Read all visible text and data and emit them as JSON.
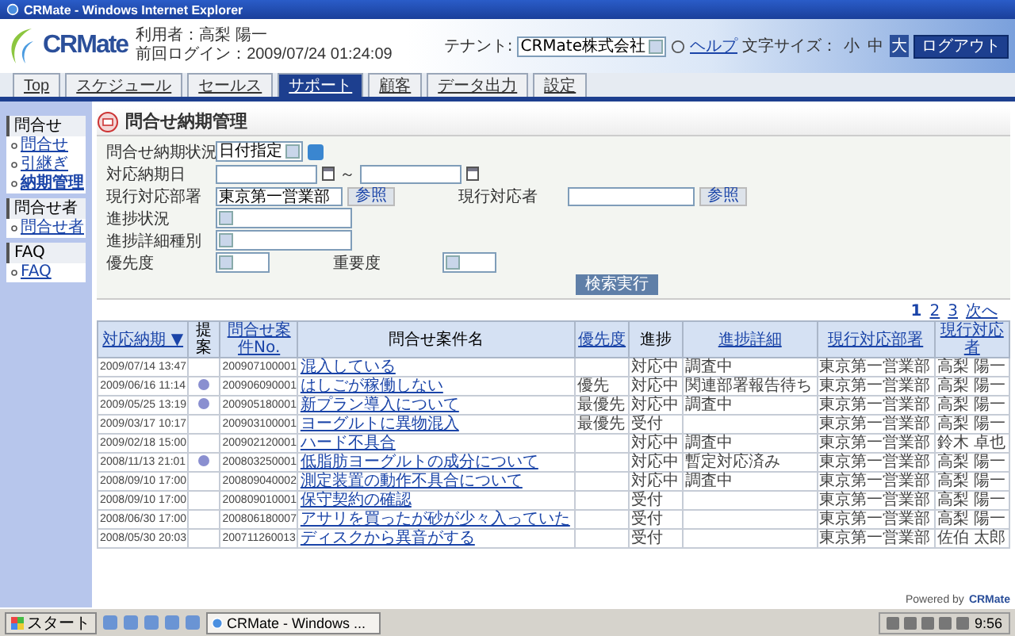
{
  "window": {
    "title": "CRMate - Windows Internet Explorer"
  },
  "header": {
    "logo": "CRMate",
    "user_label": "利用者：",
    "user_name": "高梨 陽一",
    "last_login": "前回ログイン：2009/07/24 01:24:09",
    "tenant_label": "テナント:",
    "tenant": "CRMate株式会社",
    "help": "ヘルプ",
    "font_size_label": "文字サイズ：",
    "font_sizes": [
      {
        "label": "小",
        "selected": false
      },
      {
        "label": "中",
        "selected": false
      },
      {
        "label": "大",
        "selected": true
      }
    ],
    "logout": "ログアウト"
  },
  "nav": [
    {
      "label": "Top",
      "selected": false
    },
    {
      "label": "スケジュール",
      "selected": false
    },
    {
      "label": "セールス",
      "selected": false
    },
    {
      "label": "サポート",
      "selected": true
    },
    {
      "label": "顧客",
      "selected": false
    },
    {
      "label": "データ出力",
      "selected": false
    },
    {
      "label": "設定",
      "selected": false
    }
  ],
  "sidebar": [
    {
      "title": "問合せ",
      "items": [
        {
          "label": "問合せ",
          "selected": false
        },
        {
          "label": "引継ぎ",
          "selected": false
        },
        {
          "label": "納期管理",
          "selected": true
        }
      ]
    },
    {
      "title": "問合せ者",
      "items": [
        {
          "label": "問合せ者",
          "selected": false
        }
      ]
    },
    {
      "title": "FAQ",
      "items": [
        {
          "label": "FAQ",
          "selected": false
        }
      ]
    }
  ],
  "page_title": "問合せ納期管理",
  "form": [
    {
      "fields": [
        {
          "kind": "select",
          "label": "問合せ納期状況",
          "value": "日付指定",
          "help": true
        }
      ]
    },
    {
      "fields": [
        {
          "kind": "date_range",
          "label": "対応納期日",
          "separator": "～"
        }
      ]
    },
    {
      "fields": [
        {
          "kind": "reference",
          "label": "現行対応部署",
          "value": "東京第一営業部",
          "button": "参照"
        },
        {
          "kind": "reference",
          "label": "現行対応者",
          "button": "参照"
        }
      ]
    },
    {
      "fields": [
        {
          "kind": "select",
          "label": "進捗状況",
          "wide": true
        }
      ]
    },
    {
      "fields": [
        {
          "kind": "select",
          "label": "進捗詳細種別",
          "wide": true
        }
      ]
    },
    {
      "fields": [
        {
          "kind": "select",
          "label": "優先度"
        },
        {
          "kind": "select",
          "label": "重要度"
        }
      ]
    }
  ],
  "search_button": "検索実行",
  "pagination": [
    {
      "label": "1",
      "selected": true
    },
    {
      "label": "2",
      "selected": false
    },
    {
      "label": "3",
      "selected": false
    },
    {
      "label": "次へ",
      "selected": false
    }
  ],
  "table": {
    "columns": [
      {
        "label": "対応納期 ▼",
        "sortable": true
      },
      {
        "label": "提案",
        "sortable": false
      },
      {
        "label": "問合せ案件No.",
        "sortable": true
      },
      {
        "label": "問合せ案件名",
        "sortable": false
      },
      {
        "label": "優先度",
        "sortable": true
      },
      {
        "label": "進捗",
        "sortable": false
      },
      {
        "label": "進捗詳細",
        "sortable": true
      },
      {
        "label": "現行対応部署",
        "sortable": true
      },
      {
        "label": "現行対応者",
        "sortable": true
      }
    ],
    "rows": [
      {
        "due": "2009/07/14 13:47",
        "suggested": false,
        "no": "200907100001",
        "name": "混入している",
        "priority": "",
        "progress": "対応中",
        "detail": "調査中",
        "dept": "東京第一営業部",
        "person": "高梨 陽一"
      },
      {
        "due": "2009/06/16 11:14",
        "suggested": true,
        "no": "200906090001",
        "name": "はしごが稼働しない",
        "priority": "優先",
        "progress": "対応中",
        "detail": "関連部署報告待ち",
        "dept": "東京第一営業部",
        "person": "高梨 陽一"
      },
      {
        "due": "2009/05/25 13:19",
        "suggested": true,
        "no": "200905180001",
        "name": "新プラン導入について",
        "priority": "最優先",
        "progress": "対応中",
        "detail": "調査中",
        "dept": "東京第一営業部",
        "person": "高梨 陽一"
      },
      {
        "due": "2009/03/17 10:17",
        "suggested": false,
        "no": "200903100001",
        "name": "ヨーグルトに異物混入",
        "priority": "最優先",
        "progress": "受付",
        "detail": "",
        "dept": "東京第一営業部",
        "person": "高梨 陽一"
      },
      {
        "due": "2009/02/18 15:00",
        "suggested": false,
        "no": "200902120001",
        "name": "ハード不具合",
        "priority": "",
        "progress": "対応中",
        "detail": "調査中",
        "dept": "東京第一営業部",
        "person": "鈴木 卓也"
      },
      {
        "due": "2008/11/13 21:01",
        "suggested": true,
        "no": "200803250001",
        "name": "低脂肪ヨーグルトの成分について",
        "priority": "",
        "progress": "対応中",
        "detail": "暫定対応済み",
        "dept": "東京第一営業部",
        "person": "高梨 陽一"
      },
      {
        "due": "2008/09/10 17:00",
        "suggested": false,
        "no": "200809040002",
        "name": "測定装置の動作不具合について",
        "priority": "",
        "progress": "対応中",
        "detail": "調査中",
        "dept": "東京第一営業部",
        "person": "高梨 陽一"
      },
      {
        "due": "2008/09/10 17:00",
        "suggested": false,
        "no": "200809010001",
        "name": "保守契約の確認",
        "priority": "",
        "progress": "受付",
        "detail": "",
        "dept": "東京第一営業部",
        "person": "高梨 陽一"
      },
      {
        "due": "2008/06/30 17:00",
        "suggested": false,
        "no": "200806180007",
        "name": "アサリを買ったが砂が少々入っていた",
        "priority": "",
        "progress": "受付",
        "detail": "",
        "dept": "東京第一営業部",
        "person": "高梨 陽一"
      },
      {
        "due": "2008/05/30 20:03",
        "suggested": false,
        "no": "200711260013",
        "name": "ディスクから異音がする",
        "priority": "",
        "progress": "受付",
        "detail": "",
        "dept": "東京第一営業部",
        "person": "佐伯 太郎"
      }
    ]
  },
  "footer": {
    "powered_by": "Powered by",
    "brand": "CRMate"
  },
  "taskbar": {
    "start": "スタート",
    "tasks": [
      {
        "label": "CRMate - Windows ...",
        "selected": true
      }
    ],
    "clock": "9:56"
  }
}
